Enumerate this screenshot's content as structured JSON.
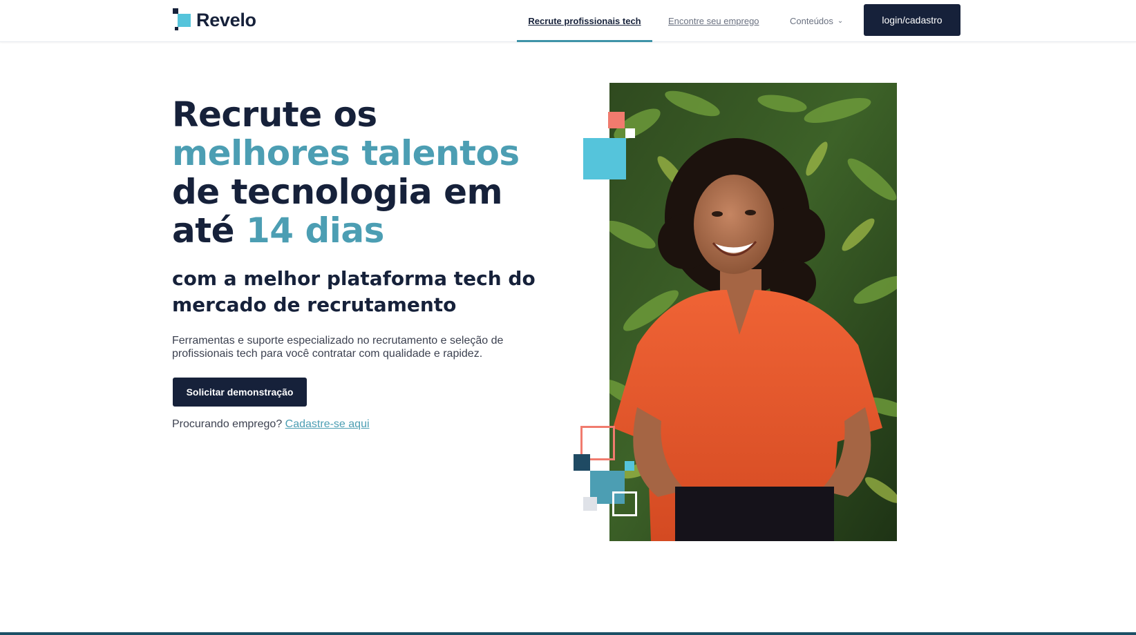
{
  "header": {
    "logo_text": "Revelo",
    "nav": {
      "active_label": "Recrute profissionais tech",
      "jobs_label": "Encontre seu emprego",
      "content_label": "Conteúdos"
    },
    "login_label": "login/cadastro"
  },
  "hero": {
    "headline": {
      "part1": "Recrute os",
      "part2_accent": "melhores talentos",
      "part3": "de tecnologia em",
      "part4": "até",
      "part5_accent": "14 dias"
    },
    "subheadline": "com a melhor plataforma tech do mercado de recrutamento",
    "description": "Ferramentas e suporte especializado no recrutamento e seleção de profissionais tech para você contratar com qualidade e rapidez.",
    "cta_label": "Solicitar demonstração",
    "job_seeker_prompt": "Procurando emprego?",
    "job_seeker_link": "Cadastre-se aqui"
  },
  "colors": {
    "navy": "#16213a",
    "accent_teal": "#4c9eb3",
    "logo_cyan": "#55c4db",
    "coral": "#f07b6e",
    "shirt_orange": "#e85a2c"
  },
  "icons": {
    "content_menu": "chevron-down-icon",
    "photo": "smiling-woman-photo"
  }
}
